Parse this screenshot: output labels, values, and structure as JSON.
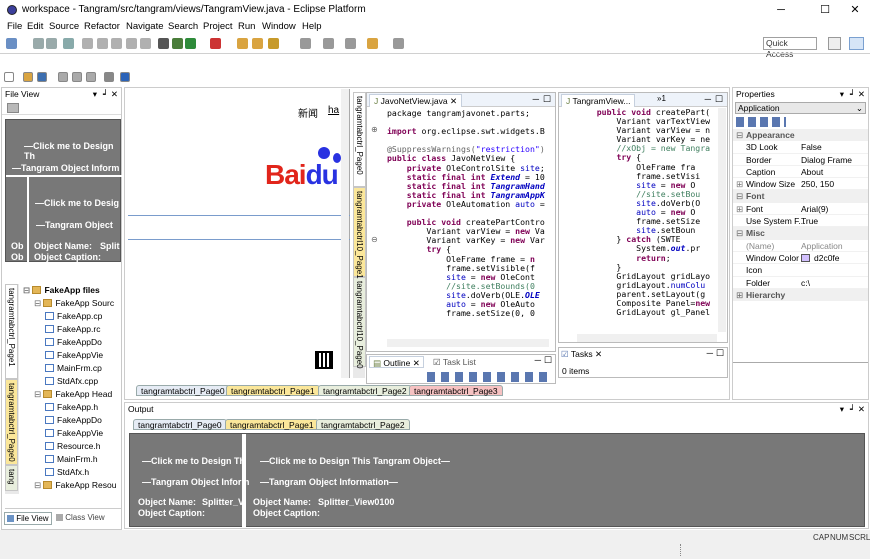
{
  "window": {
    "title": "workspace - Tangram/src/tangram/views/TangramView.java - Eclipse Platform",
    "min_glyph": "─",
    "max_glyph": "☐",
    "close_glyph": "✕"
  },
  "menu": [
    "File",
    "Edit",
    "Source",
    "Refactor",
    "Navigate",
    "Search",
    "Project",
    "Run",
    "Window",
    "Help"
  ],
  "toolbar": {
    "quick_access": "Quick Access"
  },
  "left_panel": {
    "title": "File View",
    "design_text": "—Click me to Design Th",
    "object_info_text": "—Tangram Object Inform",
    "nested_design": "—Click me to Desig",
    "nested_info": "—Tangram Object",
    "ob1": "Ob",
    "ob2": "Ob",
    "object_name_label": "Object Name:",
    "object_name_value": "Split",
    "object_caption_label": "Object Caption:",
    "vtab1": "tangramtabctrl_Page1",
    "vtab2": "tangramtabctrl_Page0",
    "vtab3": "tang",
    "tree": [
      {
        "label": "FakeApp files",
        "depth": 0,
        "bold": true,
        "type": "folder"
      },
      {
        "label": "FakeApp Sourc",
        "depth": 1,
        "type": "folder"
      },
      {
        "label": "FakeApp.cp",
        "depth": 2,
        "type": "file"
      },
      {
        "label": "FakeApp.rc",
        "depth": 2,
        "type": "file"
      },
      {
        "label": "FakeAppDo",
        "depth": 2,
        "type": "file"
      },
      {
        "label": "FakeAppVie",
        "depth": 2,
        "type": "file"
      },
      {
        "label": "MainFrm.cp",
        "depth": 2,
        "type": "file"
      },
      {
        "label": "StdAfx.cpp",
        "depth": 2,
        "type": "file"
      },
      {
        "label": "FakeApp Head",
        "depth": 1,
        "type": "folder"
      },
      {
        "label": "FakeApp.h",
        "depth": 2,
        "type": "file"
      },
      {
        "label": "FakeAppDo",
        "depth": 2,
        "type": "file"
      },
      {
        "label": "FakeAppVie",
        "depth": 2,
        "type": "file"
      },
      {
        "label": "Resource.h",
        "depth": 2,
        "type": "file"
      },
      {
        "label": "MainFrm.h",
        "depth": 2,
        "type": "file"
      },
      {
        "label": "StdAfx.h",
        "depth": 2,
        "type": "file"
      },
      {
        "label": "FakeApp Resou",
        "depth": 1,
        "type": "folder"
      }
    ],
    "bottom_tabs": [
      "File View",
      "Class View"
    ]
  },
  "browser": {
    "link1": "新闻",
    "link2": "ha",
    "logo": "Bai",
    "logo2": "du"
  },
  "center_vtabs": [
    "tangramtabctrl_Page0",
    "tangramtabctrl10_Page1",
    "tangramtabctrl10_Page0"
  ],
  "editor1": {
    "tab": "JavoNetView.java",
    "lines": [
      [
        [
          "",
          "package tangramjavonet.parts;"
        ]
      ],
      [
        [
          "",
          ""
        ]
      ],
      [
        [
          "kw",
          "import "
        ],
        [
          "",
          "org.eclipse.swt.widgets.B"
        ]
      ],
      [
        [
          "",
          ""
        ]
      ],
      [
        [
          "an",
          "@SuppressWarnings("
        ],
        [
          "st",
          "\"restriction\""
        ],
        [
          "an",
          ")"
        ]
      ],
      [
        [
          "kw",
          "public class "
        ],
        [
          "",
          "JavoNetView {"
        ]
      ],
      [
        [
          "",
          "    "
        ],
        [
          "kw",
          "private "
        ],
        [
          "",
          "OleControlSite "
        ],
        [
          "fld",
          "site"
        ],
        [
          "",
          ";"
        ]
      ],
      [
        [
          "",
          "    "
        ],
        [
          "kw",
          "static final int "
        ],
        [
          "it",
          "Extend"
        ],
        [
          "",
          " = 10"
        ]
      ],
      [
        [
          "",
          "    "
        ],
        [
          "kw",
          "static final int "
        ],
        [
          "it",
          "TangramHand"
        ]
      ],
      [
        [
          "",
          "    "
        ],
        [
          "kw",
          "static final int "
        ],
        [
          "it",
          "TangramAppK"
        ]
      ],
      [
        [
          "",
          "    "
        ],
        [
          "kw",
          "private "
        ],
        [
          "",
          "OleAutomation "
        ],
        [
          "fld",
          "auto"
        ],
        [
          "",
          " ="
        ]
      ],
      [
        [
          "",
          ""
        ]
      ],
      [
        [
          "",
          "    "
        ],
        [
          "kw",
          "public void "
        ],
        [
          "",
          "createPartContro"
        ]
      ],
      [
        [
          "",
          "        Variant "
        ],
        [
          "",
          "varView = "
        ],
        [
          "kw",
          "new "
        ],
        [
          "",
          "Va"
        ]
      ],
      [
        [
          "",
          "        Variant "
        ],
        [
          "",
          "varKey = "
        ],
        [
          "kw",
          "new "
        ],
        [
          "",
          "Var"
        ]
      ],
      [
        [
          "",
          "        "
        ],
        [
          "kw",
          "try "
        ],
        [
          "",
          "{"
        ]
      ],
      [
        [
          "",
          "            OleFrame "
        ],
        [
          "",
          "frame = "
        ],
        [
          "kw",
          "n"
        ]
      ],
      [
        [
          "",
          "            frame.setVisible(f"
        ]
      ],
      [
        [
          "",
          "            "
        ],
        [
          "fld",
          "site"
        ],
        [
          "",
          " = "
        ],
        [
          "kw",
          "new "
        ],
        [
          "",
          "OleCont"
        ]
      ],
      [
        [
          "",
          "            "
        ],
        [
          "cm",
          "//site.setBounds(0"
        ]
      ],
      [
        [
          "",
          "            "
        ],
        [
          "fld",
          "site"
        ],
        [
          "",
          ".doVerb(OLE."
        ],
        [
          "it",
          "OLE"
        ]
      ],
      [
        [
          "",
          "            "
        ],
        [
          "fld",
          "auto"
        ],
        [
          "",
          " = "
        ],
        [
          "kw",
          "new "
        ],
        [
          "",
          "OleAuto"
        ]
      ],
      [
        [
          "",
          "            frame.setSize(0, 0"
        ]
      ]
    ]
  },
  "editor2": {
    "tab": "TangramView...",
    "overflow": "»1",
    "lines": [
      [
        [
          "",
          "    "
        ],
        [
          "kw",
          "public void "
        ],
        [
          "",
          "createPart("
        ]
      ],
      [
        [
          "",
          "        Variant "
        ],
        [
          "",
          "varTextView"
        ]
      ],
      [
        [
          "",
          "        Variant "
        ],
        [
          "",
          "varView = n"
        ]
      ],
      [
        [
          "",
          "        Variant "
        ],
        [
          "",
          "varKey = ne"
        ]
      ],
      [
        [
          "",
          "        "
        ],
        [
          "cm",
          "//xObj = new Tangra"
        ]
      ],
      [
        [
          "",
          "        "
        ],
        [
          "kw",
          "try "
        ],
        [
          "",
          "{"
        ]
      ],
      [
        [
          "",
          "            OleFrame "
        ],
        [
          "",
          "fra"
        ]
      ],
      [
        [
          "",
          "            frame.setVisi"
        ]
      ],
      [
        [
          "",
          "            "
        ],
        [
          "fld",
          "site"
        ],
        [
          "",
          " = "
        ],
        [
          "kw",
          "new "
        ],
        [
          "",
          "O"
        ]
      ],
      [
        [
          "",
          "            "
        ],
        [
          "cm",
          "//site.setBou"
        ]
      ],
      [
        [
          "",
          "            "
        ],
        [
          "fld",
          "site"
        ],
        [
          "",
          ".doVerb(O"
        ]
      ],
      [
        [
          "",
          "            "
        ],
        [
          "fld",
          "auto"
        ],
        [
          "",
          " = "
        ],
        [
          "kw",
          "new "
        ],
        [
          "",
          "O"
        ]
      ],
      [
        [
          "",
          "            frame.setSize"
        ]
      ],
      [
        [
          "",
          "            "
        ],
        [
          "fld",
          "site"
        ],
        [
          "",
          ".setBoun"
        ]
      ],
      [
        [
          "",
          "        } "
        ],
        [
          "kw",
          "catch "
        ],
        [
          "",
          "(SWTE"
        ]
      ],
      [
        [
          "",
          "            System."
        ],
        [
          "it",
          "out"
        ],
        [
          "",
          ".pr"
        ]
      ],
      [
        [
          "",
          "            "
        ],
        [
          "kw",
          "return"
        ],
        [
          "",
          ";"
        ]
      ],
      [
        [
          "",
          "        }"
        ]
      ],
      [
        [
          "",
          "        GridLayout gridLayo"
        ]
      ],
      [
        [
          "",
          "        gridLayout."
        ],
        [
          "fld",
          "numColu"
        ]
      ],
      [
        [
          "",
          "        parent.setLayout(g"
        ]
      ],
      [
        [
          "",
          "        Composite Panel="
        ],
        [
          "kw",
          "new"
        ]
      ],
      [
        [
          "",
          "        GridLayout gl_Panel"
        ]
      ]
    ]
  },
  "outline": {
    "tab": "Outline",
    "tab2": "Task List"
  },
  "tasks": {
    "tab": "Tasks",
    "items": "0 items"
  },
  "center_bottom_tabs": [
    "tangramtabctrl_Page0",
    "tangramtabctrl_Page1",
    "tangramtabctrl_Page2",
    "tangramtabctrl_Page3"
  ],
  "properties": {
    "title": "Properties",
    "selector": "Application",
    "rows": [
      {
        "cat": true,
        "k": "Appearance"
      },
      {
        "k": "3D Look",
        "v": "False"
      },
      {
        "k": "Border",
        "v": "Dialog Frame"
      },
      {
        "k": "Caption",
        "v": "About"
      },
      {
        "k": "Window Size",
        "v": "250, 150",
        "expand": true
      },
      {
        "cat": true,
        "k": "Font"
      },
      {
        "k": "Font",
        "v": "Arial(9)",
        "expand": true
      },
      {
        "k": "Use System F...",
        "v": "True"
      },
      {
        "cat": true,
        "k": "Misc"
      },
      {
        "k": "(Name)",
        "v": "Application",
        "dim": true
      },
      {
        "k": "Window Color",
        "v": "d2c0fe",
        "swatch": "#d2c0fe"
      },
      {
        "k": "Icon",
        "v": ""
      },
      {
        "k": "Folder",
        "v": "c:\\"
      },
      {
        "cat": true,
        "k": "Hierarchy",
        "collapsed": true
      }
    ]
  },
  "output": {
    "title": "Output",
    "tabs": [
      "tangramtabctrl_Page0",
      "tangramtabctrl_Page1",
      "tangramtabctrl_Page2"
    ],
    "left_design": "—Click me to Design Th",
    "left_info": "—Tangram Object Inform",
    "left_name_label": "Object Name:",
    "left_name_value": "Splitter_V",
    "left_caption_label": "Object Caption:",
    "right_design": "—Click me to Design This Tangram Object—",
    "right_info": "—Tangram Object Information—",
    "right_name_label": "Object Name:",
    "right_name_value": "Splitter_View0100",
    "right_caption_label": "Object Caption:"
  },
  "status": {
    "cap": "CAP",
    "num": "NUM",
    "scrl": "SCRL"
  }
}
